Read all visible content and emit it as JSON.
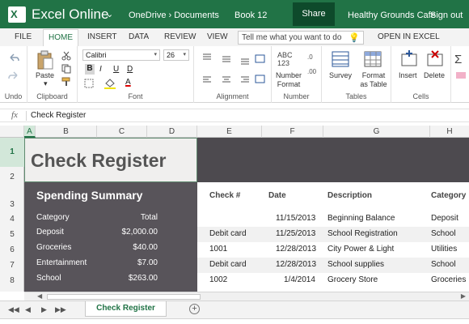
{
  "titlebar": {
    "app_name": "Excel Online",
    "path": "OneDrive › Documents",
    "book": "Book 12",
    "share": "Share",
    "account": "Healthy Grounds Cafe",
    "sign_out": "Sign out"
  },
  "tabs": [
    "FILE",
    "HOME",
    "INSERT",
    "DATA",
    "REVIEW",
    "VIEW"
  ],
  "tell_me_placeholder": "Tell me what you want to do",
  "open_in_excel": "OPEN IN EXCEL",
  "ribbon": {
    "undo_label": "Undo",
    "paste_label": "Paste",
    "clipboard_label": "Clipboard",
    "font_name": "Calibri",
    "font_size": "26",
    "bold": "B",
    "italic": "I",
    "underline": "U",
    "double_underline": "D",
    "font_color_glyph": "A",
    "font_label": "Font",
    "alignment_label": "Alignment",
    "number_glyph": "ABC 123",
    "number_format_label": "Number Format",
    "number_label": "Number",
    "survey_label": "Survey",
    "format_table_label": "Format as Table",
    "tables_label": "Tables",
    "insert_label": "Insert",
    "delete_label": "Delete",
    "cells_label": "Cells"
  },
  "formula_bar": {
    "fx": "fx",
    "value": "Check Register"
  },
  "columns": [
    "A",
    "B",
    "C",
    "D",
    "E",
    "F",
    "G",
    "H"
  ],
  "rows": [
    "1",
    "2",
    "3",
    "4",
    "5",
    "6",
    "7",
    "8"
  ],
  "sheet": {
    "title": "Check Register",
    "summary": {
      "heading": "Spending Summary",
      "col_category": "Category",
      "col_total": "Total",
      "items": [
        {
          "category": "Deposit",
          "total": "$2,000.00"
        },
        {
          "category": "Groceries",
          "total": "$40.00"
        },
        {
          "category": "Entertainment",
          "total": "$7.00"
        },
        {
          "category": "School",
          "total": "$263.00"
        }
      ]
    },
    "register_headers": {
      "check": "Check #",
      "date": "Date",
      "description": "Description",
      "category": "Category"
    },
    "register_rows": [
      {
        "check": "",
        "date": "11/15/2013",
        "description": "Beginning Balance",
        "category": "Deposit"
      },
      {
        "check": "Debit card",
        "date": "11/25/2013",
        "description": "School Registration",
        "category": "School"
      },
      {
        "check": "1001",
        "date": "12/28/2013",
        "description": "City Power & Light",
        "category": "Utilities"
      },
      {
        "check": "Debit card",
        "date": "12/28/2013",
        "description": "School supplies",
        "category": "School"
      },
      {
        "check": "1002",
        "date": "1/4/2014",
        "description": "Grocery Store",
        "category": "Groceries"
      }
    ]
  },
  "sheet_tab": "Check Register",
  "add_sheet": "+"
}
